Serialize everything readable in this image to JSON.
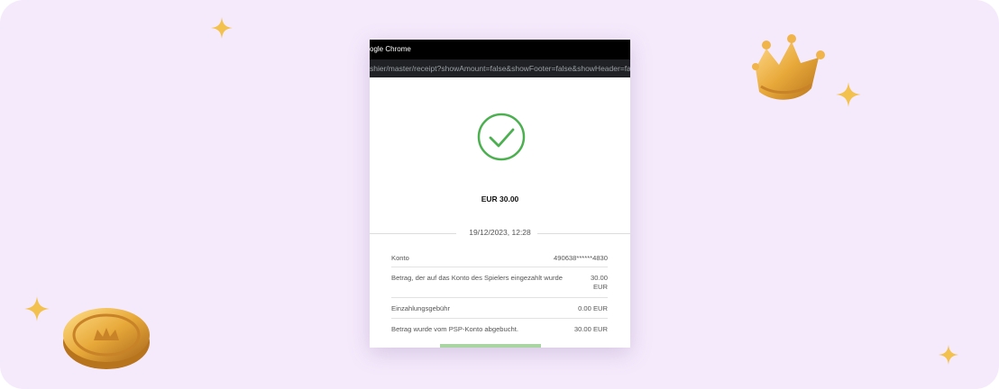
{
  "browser": {
    "title": "ogle Chrome",
    "url": "shier/master/receipt?showAmount=false&showFooter=false&showHeader=fa"
  },
  "receipt": {
    "amount": "EUR 30.00",
    "datetime": "19/12/2023, 12:28",
    "rows": [
      {
        "label": "Konto",
        "value": "490638******4830"
      },
      {
        "label": "Betrag, der auf das Konto des Spielers eingezahlt wurde",
        "value_line1": "30.00",
        "value_line2": "EUR"
      },
      {
        "label": "Einzahlungsgebühr",
        "value": "0.00 EUR"
      },
      {
        "label": "Betrag wurde vom PSP-Konto abgebucht.",
        "value": "30.00 EUR"
      }
    ]
  },
  "colors": {
    "background": "#f5eafc",
    "success": "#4caf50",
    "gold": "#e8a93a"
  },
  "icons": [
    "sparkle-icon",
    "crown-icon",
    "coin-icon",
    "checkmark-circle-icon"
  ]
}
